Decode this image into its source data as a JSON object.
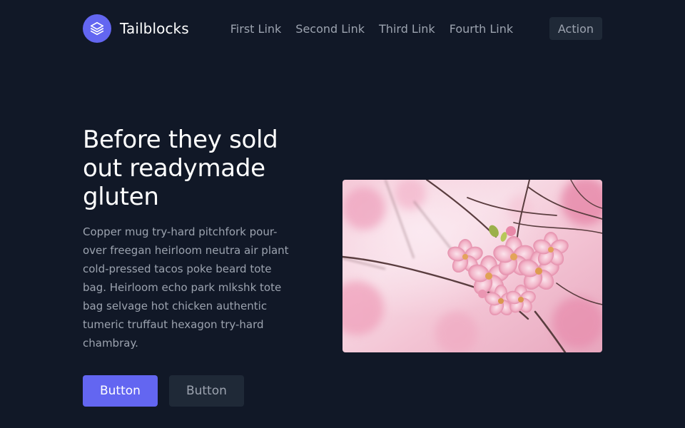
{
  "header": {
    "brand_name": "Tailblocks",
    "logo_icon": "stack-layers-icon",
    "nav_links": [
      "First Link",
      "Second Link",
      "Third Link",
      "Fourth Link"
    ],
    "action_label": "Action"
  },
  "hero": {
    "title": "Before they sold out readymade gluten",
    "body": "Copper mug try-hard pitchfork pour-over freegan heirloom neutra air plant cold-pressed tacos poke beard tote bag. Heirloom echo park mlkshk tote bag selvage hot chicken authentic tumeric truffaut hexagon try-hard chambray.",
    "primary_button": "Button",
    "secondary_button": "Button",
    "image_subject": "pink cherry blossom branch"
  },
  "colors": {
    "background": "#111827",
    "accent": "#6366f1",
    "secondary_surface": "#1f2937",
    "muted_text": "#9ca3af",
    "heading_text": "#ffffff"
  }
}
